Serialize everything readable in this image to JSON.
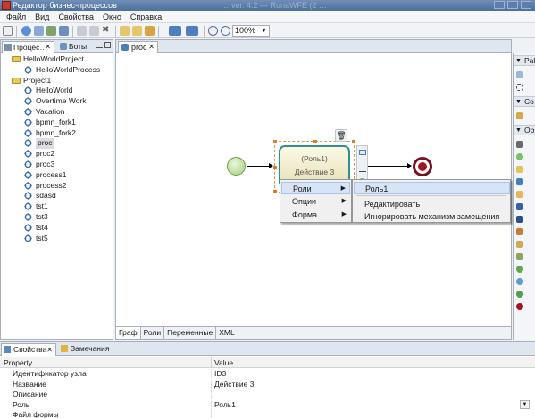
{
  "window": {
    "title": "Редактор бизнес-процессов",
    "blurred_text": "…ver. 4.2 — RunaWFE (2 …"
  },
  "menu": [
    "Файл",
    "Вид",
    "Свойства",
    "Окно",
    "Справка"
  ],
  "toolbar": {
    "zoom": "100%"
  },
  "left_panel": {
    "tabs": [
      "Процес…",
      "Боты"
    ],
    "tree": [
      {
        "label": "HelloWorldProject",
        "type": "project",
        "level": 0
      },
      {
        "label": "HelloWorldProcess",
        "type": "process",
        "level": 1
      },
      {
        "label": "Project1",
        "type": "project",
        "level": 0
      },
      {
        "label": "HelloWorld",
        "type": "process",
        "level": 1
      },
      {
        "label": "Overtime Work",
        "type": "process",
        "level": 1
      },
      {
        "label": "Vacation",
        "type": "process",
        "level": 1
      },
      {
        "label": "bpmn_fork1",
        "type": "process",
        "level": 1
      },
      {
        "label": "bpmn_fork2",
        "type": "process",
        "level": 1
      },
      {
        "label": "proc",
        "type": "process",
        "level": 1,
        "selected": true
      },
      {
        "label": "proc2",
        "type": "process",
        "level": 1
      },
      {
        "label": "proc3",
        "type": "process",
        "level": 1
      },
      {
        "label": "process1",
        "type": "process",
        "level": 1
      },
      {
        "label": "process2",
        "type": "process",
        "level": 1
      },
      {
        "label": "sdasd",
        "type": "process",
        "level": 1
      },
      {
        "label": "tst1",
        "type": "process",
        "level": 1
      },
      {
        "label": "tst3",
        "type": "process",
        "level": 1
      },
      {
        "label": "tst4",
        "type": "process",
        "level": 1
      },
      {
        "label": "tst5",
        "type": "process",
        "level": 1
      }
    ]
  },
  "editor": {
    "tab": "proc",
    "bottom_tabs": [
      "Граф",
      "Роли",
      "Переменные",
      "XML"
    ],
    "task": {
      "role": "(Роль1)",
      "name": "Действие 3"
    },
    "context_menu": [
      {
        "label": "Роли",
        "submenu": true
      },
      {
        "label": "Опции",
        "submenu": true
      },
      {
        "label": "Форма",
        "submenu": true
      }
    ],
    "submenu": [
      "Роль1",
      "Редактировать",
      "Игнорировать механизм замещения"
    ]
  },
  "palette": {
    "sections": [
      "Pal",
      "Co",
      "Ob"
    ]
  },
  "properties": {
    "tabs": [
      "Свойства",
      "Замечания"
    ],
    "columns": [
      "Property",
      "Value"
    ],
    "rows": [
      {
        "key": "Идентификатор узла",
        "value": "ID3"
      },
      {
        "key": "Название",
        "value": "Действие 3"
      },
      {
        "key": "Описание",
        "value": ""
      },
      {
        "key": "Роль",
        "value": "Роль1"
      },
      {
        "key": "Файл формы",
        "value": ""
      }
    ]
  },
  "colors": {
    "accent": "#2f8f8f",
    "start": "#a6cf80",
    "end": "#9e1526",
    "hover": "#d7e4f6"
  }
}
